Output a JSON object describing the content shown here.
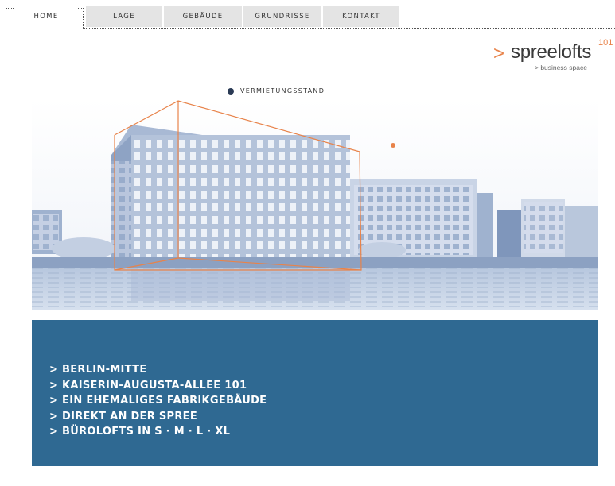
{
  "nav": {
    "tabs": [
      {
        "label": "HOME"
      },
      {
        "label": "LAGE"
      },
      {
        "label": "GEBÄUDE"
      },
      {
        "label": "GRUNDRISSE"
      },
      {
        "label": "KONTAKT"
      }
    ]
  },
  "logo": {
    "arrow": ">",
    "name": "spreelofts",
    "number": "101",
    "tagline": "> business space"
  },
  "vermietung": {
    "label": "VERMIETUNGSSTAND"
  },
  "features": [
    "> BERLIN-MITTE",
    "> KAISERIN-AUGUSTA-ALLEE 101",
    "> EIN EHEMALIGES FABRIKGEBÄUDE",
    "> DIREKT AN DER SPREE",
    "> BÜROLOFTS IN  S · M · L · XL"
  ],
  "colors": {
    "accent": "#e8834a",
    "panel": "#2f6992",
    "tab_inactive": "#e4e4e4"
  }
}
